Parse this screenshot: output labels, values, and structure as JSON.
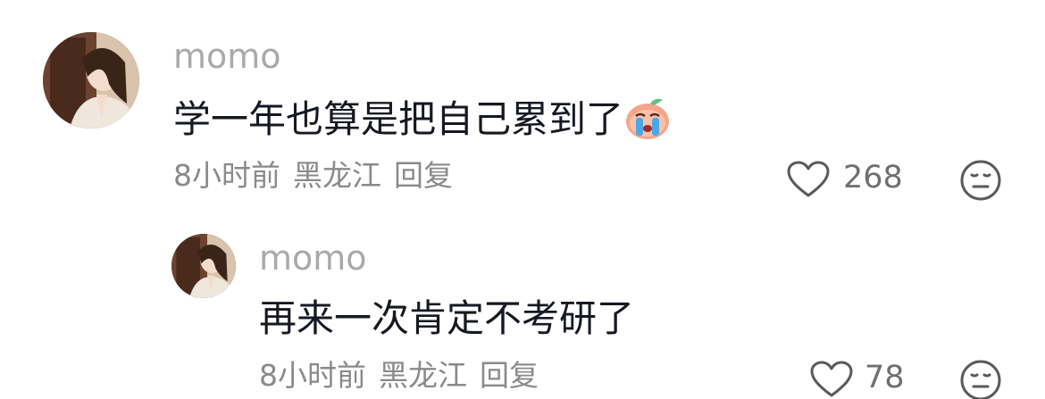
{
  "comments": [
    {
      "username": "momo",
      "text": "学一年也算是把自己累到了",
      "emoji": "crying-face-emoji",
      "time": "8小时前",
      "location": "黑龙江",
      "reply_label": "回复",
      "likes": "268"
    },
    {
      "username": "momo",
      "text": "再来一次肯定不考研了",
      "time": "8小时前",
      "location": "黑龙江",
      "reply_label": "回复",
      "likes": "78"
    }
  ],
  "icons": {
    "like": "heart-outline-icon",
    "dislike": "meh-face-icon"
  },
  "colors": {
    "username": "#a9a9a9",
    "comment_text": "#161823",
    "meta_text": "#8a8a8a"
  }
}
